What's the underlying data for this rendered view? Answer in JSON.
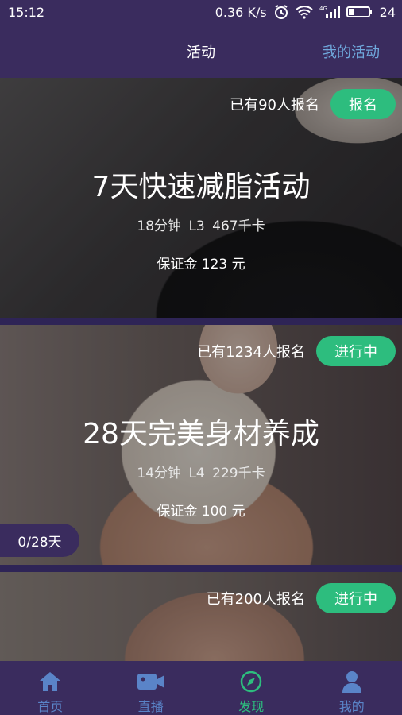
{
  "status_bar": {
    "time": "15:12",
    "net_speed": "0.36 K/s",
    "network_type": "4G",
    "battery": "24"
  },
  "nav": {
    "title": "活动",
    "my_activities": "我的活动"
  },
  "activities": [
    {
      "signup_count": "已有90人报名",
      "status_label": "报名",
      "title": "7天快速减脂活动",
      "meta": "18分钟  L3  467千卡",
      "deposit": "保证金 123 元",
      "progress": ""
    },
    {
      "signup_count": "已有1234人报名",
      "status_label": "进行中",
      "title": "28天完美身材养成",
      "meta": "14分钟  L4  229千卡",
      "deposit": "保证金 100 元",
      "progress": "0/28天"
    },
    {
      "signup_count": "已有200人报名",
      "status_label": "进行中",
      "title": "",
      "meta": "",
      "deposit": "",
      "progress": ""
    }
  ],
  "tabs": [
    {
      "label": "首页",
      "icon": "home-icon"
    },
    {
      "label": "直播",
      "icon": "video-camera-icon"
    },
    {
      "label": "发现",
      "icon": "compass-icon",
      "active": true
    },
    {
      "label": "我的",
      "icon": "user-icon"
    }
  ],
  "colors": {
    "primary_purple": "#3a2c5e",
    "accent_green": "#2dbd7e",
    "link_blue": "#6fa8dc",
    "tab_inactive": "#5a84c8"
  }
}
